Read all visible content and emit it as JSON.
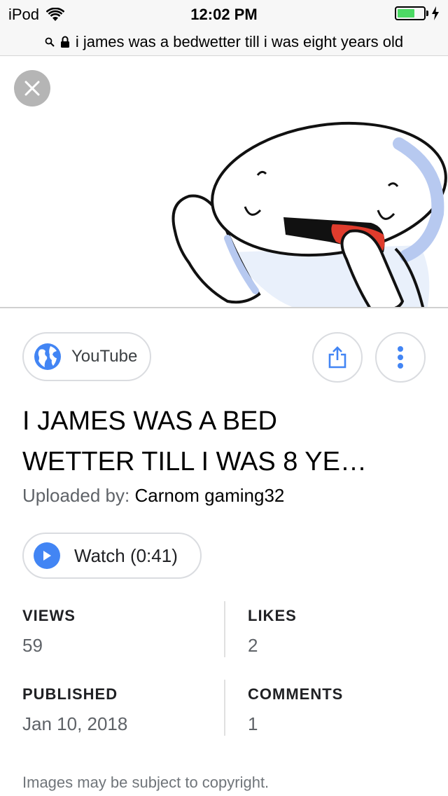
{
  "status_bar": {
    "carrier": "iPod",
    "time": "12:02 PM"
  },
  "url_bar": {
    "query": "i james was a bedwetter till i was eight years old"
  },
  "source": {
    "label": "YouTube"
  },
  "video": {
    "title_line1": "I JAMES WAS A BED",
    "title_line2": "WETTER TILL I WAS 8 YE…",
    "uploaded_by_label": "Uploaded by:",
    "uploader": "Carnom gaming32",
    "watch_label": "Watch (0:41)"
  },
  "stats": {
    "views_label": "VIEWS",
    "views": "59",
    "likes_label": "LIKES",
    "likes": "2",
    "published_label": "PUBLISHED",
    "published": "Jan 10, 2018",
    "comments_label": "COMMENTS",
    "comments": "1"
  },
  "footer": {
    "copyright": "Images may be subject to copyright."
  },
  "colors": {
    "accent_blue": "#4285f4",
    "battery_green": "#4cd964",
    "close_gray": "#b5b5b5"
  },
  "icons": [
    "wifi-icon",
    "battery-icon",
    "charging-icon",
    "search-icon",
    "lock-icon",
    "close-icon",
    "globe-icon",
    "share-icon",
    "more-vert-icon",
    "play-icon"
  ]
}
